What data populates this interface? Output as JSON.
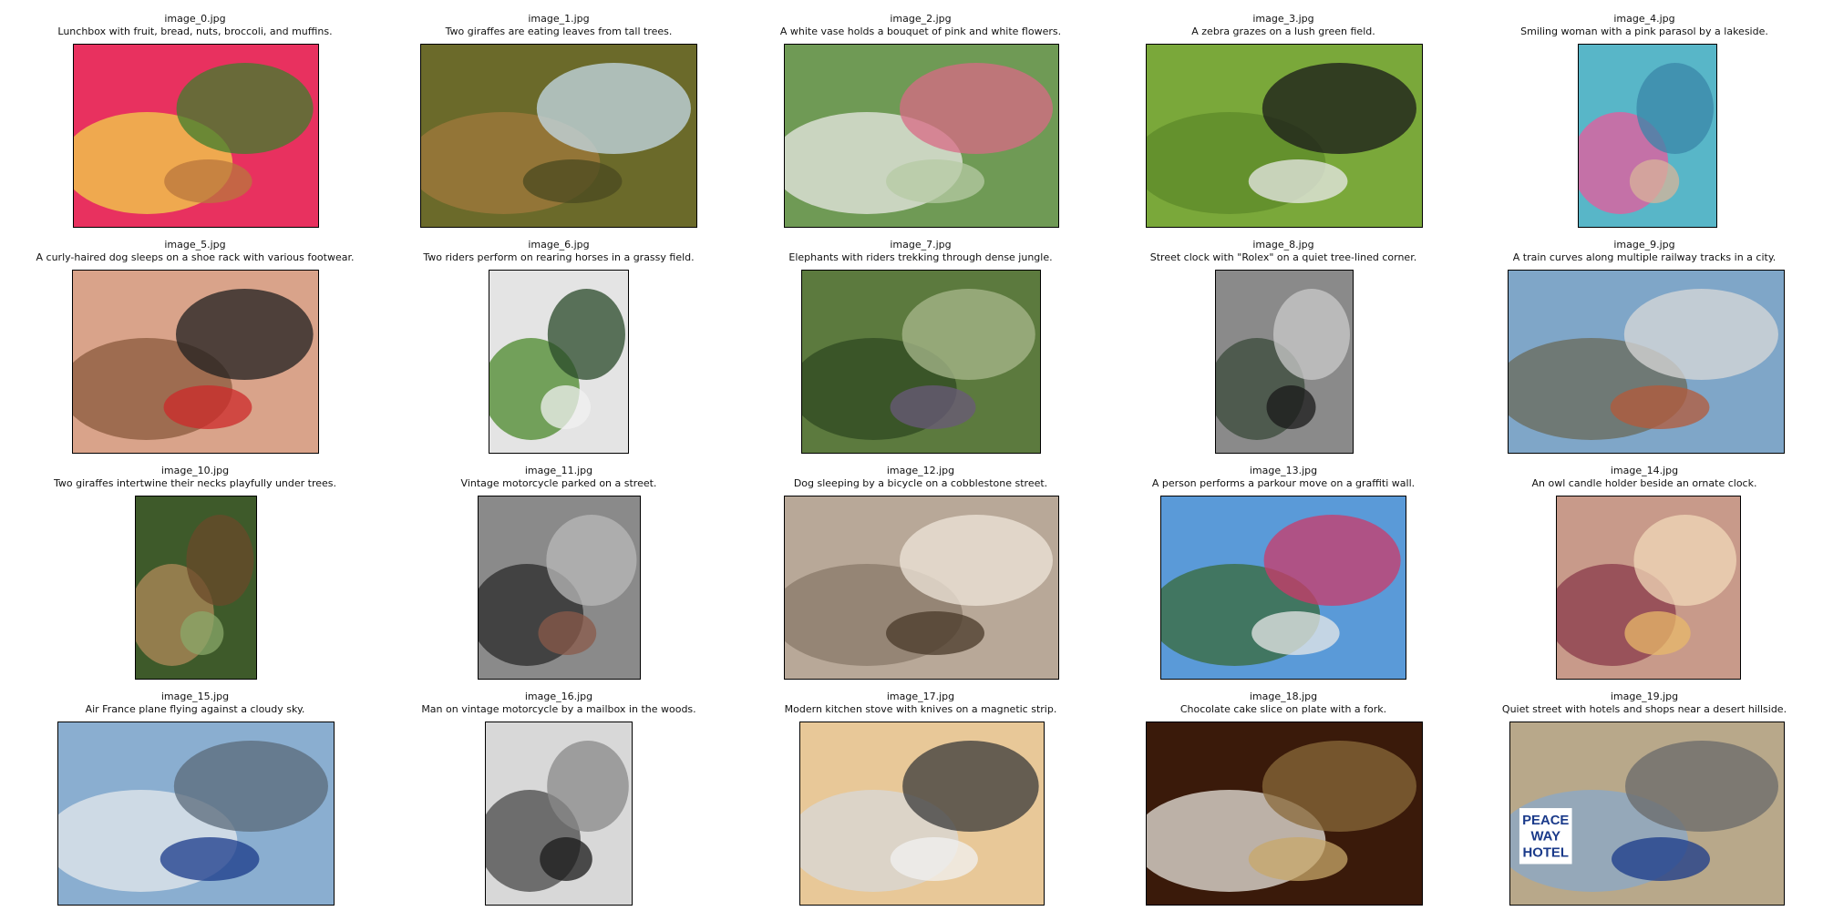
{
  "images": [
    {
      "file": "image_0.jpg",
      "caption": "Lunchbox with fruit, bread, nuts, broccoli, and muffins.",
      "palette": [
        "#e8315f",
        "#f1d24a",
        "#3f7d2c",
        "#b9773c"
      ]
    },
    {
      "file": "image_1.jpg",
      "caption": "Two giraffes are eating leaves from tall trees.",
      "palette": [
        "#6b6a2a",
        "#a07a3c",
        "#c4dbe8",
        "#4a4a20"
      ]
    },
    {
      "file": "image_2.jpg",
      "caption": "A white vase holds a bouquet of pink and white flowers.",
      "palette": [
        "#6f9a55",
        "#e8e8e4",
        "#d86a86",
        "#b5c9a4"
      ]
    },
    {
      "file": "image_3.jpg",
      "caption": "A zebra grazes on a lush green field.",
      "palette": [
        "#7aa83a",
        "#5d8a2a",
        "#1a1a1a",
        "#e9e9e9"
      ]
    },
    {
      "file": "image_4.jpg",
      "caption": "Smiling woman with a pink parasol by a lakeside.",
      "palette": [
        "#58b6c8",
        "#e85a9c",
        "#3a86a8",
        "#d8b49a"
      ]
    },
    {
      "file": "image_5.jpg",
      "caption": "A curly-haired dog sleeps on a shoe rack with various footwear.",
      "palette": [
        "#d9a38a",
        "#8a5a3c",
        "#1f1f1f",
        "#cc2a2a"
      ]
    },
    {
      "file": "image_6.jpg",
      "caption": "Two riders perform on rearing horses in a grassy field.",
      "palette": [
        "#e4e4e4",
        "#4c8a2c",
        "#2a4a2a",
        "#f2f2f2"
      ]
    },
    {
      "file": "image_7.jpg",
      "caption": "Elephants with riders trekking through dense jungle.",
      "palette": [
        "#5c7a3e",
        "#2f4a22",
        "#a8b88c",
        "#6a5a7a"
      ]
    },
    {
      "file": "image_8.jpg",
      "caption": "Street clock with \"Rolex\" on a quiet tree-lined corner.",
      "palette": [
        "#8a8a8a",
        "#3a4a3a",
        "#c9c9c9",
        "#1a1a1a"
      ]
    },
    {
      "file": "image_9.jpg",
      "caption": "A train curves along multiple railway tracks in a city.",
      "palette": [
        "#7fa6c8",
        "#6a6a5a",
        "#d8d8d8",
        "#b45a3a"
      ]
    },
    {
      "file": "image_10.jpg",
      "caption": "Two giraffes intertwine their necks playfully under trees.",
      "palette": [
        "#3e5a2a",
        "#b08a5a",
        "#6a4a2a",
        "#8aa86a"
      ]
    },
    {
      "file": "image_11.jpg",
      "caption": "Vintage motorcycle parked on a street.",
      "palette": [
        "#8a8a8a",
        "#2a2a2a",
        "#b8b8b8",
        "#8a5a4a"
      ]
    },
    {
      "file": "image_12.jpg",
      "caption": "Dog sleeping by a bicycle on a cobblestone street.",
      "palette": [
        "#b8a898",
        "#8a7a6a",
        "#efe6da",
        "#4a3a2a"
      ]
    },
    {
      "file": "image_13.jpg",
      "caption": "A person performs a parkour move on a graffiti wall.",
      "palette": [
        "#5a9ad8",
        "#3a6a3a",
        "#cc3a6a",
        "#e8e8e8"
      ]
    },
    {
      "file": "image_14.jpg",
      "caption": "An owl candle holder beside an ornate clock.",
      "palette": [
        "#c89a8a",
        "#8a3a4a",
        "#f2d8b8",
        "#e8b86a"
      ]
    },
    {
      "file": "image_15.jpg",
      "caption": "Air France plane flying against a cloudy sky.",
      "palette": [
        "#8aaed0",
        "#e4e8ec",
        "#5a6a7a",
        "#1a3a8a"
      ]
    },
    {
      "file": "image_16.jpg",
      "caption": "Man on vintage motorcycle by a mailbox in the woods.",
      "palette": [
        "#d8d8d8",
        "#4a4a4a",
        "#8a8a8a",
        "#1a1a1a"
      ]
    },
    {
      "file": "image_17.jpg",
      "caption": "Modern kitchen stove with knives on a magnetic strip.",
      "palette": [
        "#e8c898",
        "#d8d8d8",
        "#3a3a3a",
        "#f2f2f2"
      ]
    },
    {
      "file": "image_18.jpg",
      "caption": "Chocolate cake slice on plate with a fork.",
      "palette": [
        "#3a1a0a",
        "#e8e4dc",
        "#8a6a3a",
        "#c8a86a"
      ]
    },
    {
      "file": "image_19.jpg",
      "caption": "Quiet street with hotels and shops near a desert hillside.",
      "palette": [
        "#b8a88a",
        "#8aa8c8",
        "#6a6a6a",
        "#1a3a8a"
      ]
    }
  ],
  "sign_text": {
    "image_19": [
      "PEACE",
      "WAY",
      "HOTEL"
    ]
  }
}
